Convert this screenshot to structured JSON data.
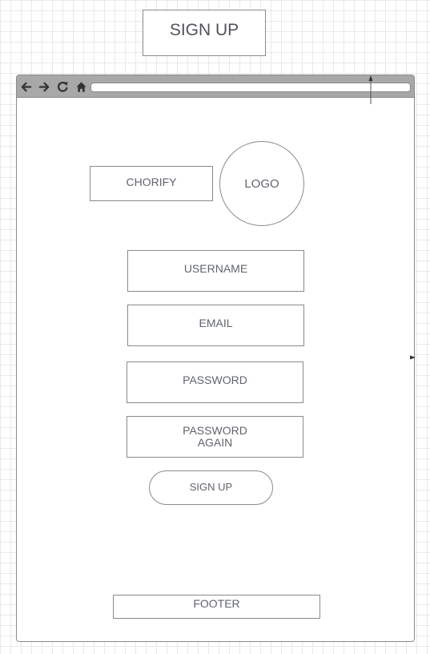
{
  "page_title": "SIGN UP",
  "browser": {
    "nav_icons": [
      "back-arrow-icon",
      "forward-arrow-icon",
      "reload-icon",
      "home-icon"
    ],
    "address_value": ""
  },
  "brand": {
    "name": "CHORIFY",
    "logo_label": "LOGO"
  },
  "form": {
    "username_label": "USERNAME",
    "email_label": "EMAIL",
    "password_label": "PASSWORD",
    "password_again_line1": "PASSWORD",
    "password_again_line2": "AGAIN",
    "submit_label": "SIGN UP"
  },
  "footer": {
    "label": "FOOTER"
  },
  "colors": {
    "grid": "#e9e9e9",
    "border": "#8a8a8a",
    "toolbar": "#a8a8a8",
    "text": "#60646c"
  }
}
